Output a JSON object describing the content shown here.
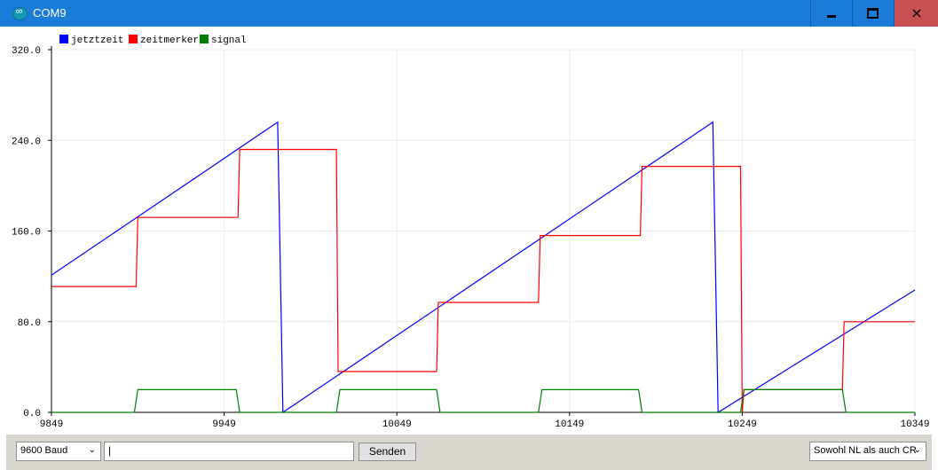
{
  "window": {
    "title": "COM9",
    "controls": {
      "minimize": "minimize",
      "maximize": "maximize",
      "close": "×"
    }
  },
  "toolbar": {
    "baud_rate": "9600 Baud",
    "message_input_value": "",
    "send_label": "Senden",
    "line_ending": "Sowohl NL als auch CR"
  },
  "colors": {
    "jetztzeit": "#0000ff",
    "zeitmerker": "#ff0000",
    "signal": "#008000"
  },
  "chart_data": {
    "type": "line",
    "ylim": [
      0,
      320
    ],
    "xlim": [
      9849,
      10349
    ],
    "y_ticks": [
      "320.0",
      "240.0",
      "160.0",
      "80.0",
      "0.0"
    ],
    "x_ticks": [
      "9849",
      "9949",
      "10049",
      "10149",
      "10249",
      "10349"
    ],
    "grid": true,
    "legend_placement": "top-left",
    "series": [
      {
        "name": "jetztzeit",
        "color": "#0000ff",
        "points": [
          [
            9849,
            121
          ],
          [
            9980,
            256
          ],
          [
            9983,
            0
          ],
          [
            10232,
            256
          ],
          [
            10235,
            0
          ],
          [
            10349,
            108
          ]
        ]
      },
      {
        "name": "zeitmerker",
        "color": "#ff0000",
        "points": [
          [
            9849,
            111
          ],
          [
            9898,
            111
          ],
          [
            9899,
            172
          ],
          [
            9957,
            172
          ],
          [
            9958,
            232
          ],
          [
            10014,
            232
          ],
          [
            10015,
            36
          ],
          [
            10072,
            36
          ],
          [
            10073,
            97
          ],
          [
            10131,
            97
          ],
          [
            10132,
            156
          ],
          [
            10190,
            156
          ],
          [
            10191,
            217
          ],
          [
            10248,
            217
          ],
          [
            10249,
            0
          ],
          [
            10250,
            20
          ],
          [
            10307,
            20
          ],
          [
            10308,
            80
          ],
          [
            10349,
            80
          ]
        ]
      },
      {
        "name": "signal",
        "color": "#008000",
        "points": [
          [
            9849,
            0
          ],
          [
            9897,
            0
          ],
          [
            9899,
            20
          ],
          [
            9956,
            20
          ],
          [
            9958,
            0
          ],
          [
            10014,
            0
          ],
          [
            10016,
            20
          ],
          [
            10072,
            20
          ],
          [
            10074,
            0
          ],
          [
            10131,
            0
          ],
          [
            10133,
            20
          ],
          [
            10189,
            20
          ],
          [
            10191,
            0
          ],
          [
            10248,
            0
          ],
          [
            10250,
            20
          ],
          [
            10307,
            20
          ],
          [
            10309,
            0
          ],
          [
            10349,
            0
          ]
        ]
      }
    ]
  }
}
